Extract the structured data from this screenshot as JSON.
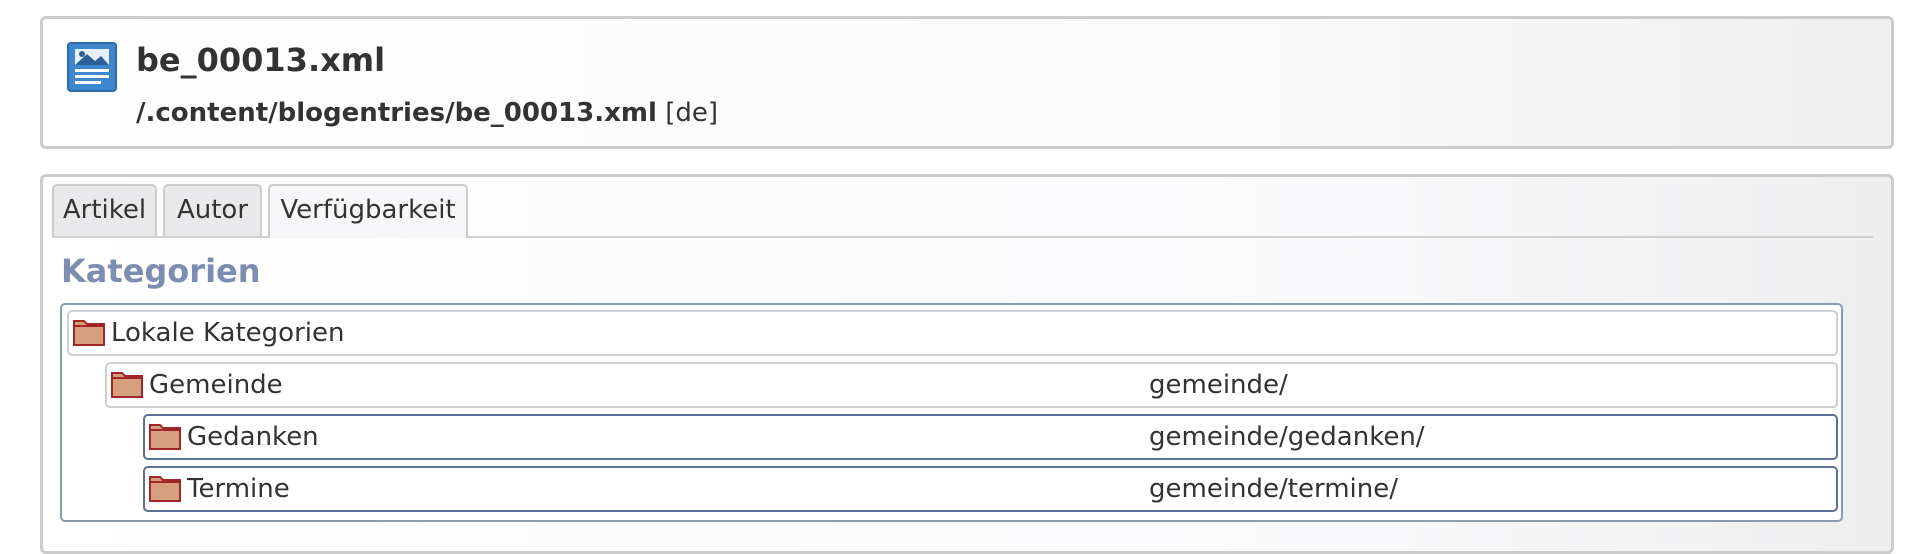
{
  "header": {
    "file_name": "be_00013.xml",
    "file_path": "/.content/blogentries/be_00013.xml",
    "locale": "[de]",
    "icon": "document-image-icon"
  },
  "tabs": [
    {
      "label": "Artikel",
      "active": false
    },
    {
      "label": "Autor",
      "active": false
    },
    {
      "label": "Verfügbarkeit",
      "active": true
    }
  ],
  "section": {
    "title": "Kategorien"
  },
  "categories": [
    {
      "label": "Lokale Kategorien",
      "path": "",
      "level": 0,
      "icon": "folder-icon",
      "selected": false
    },
    {
      "label": "Gemeinde",
      "path": "gemeinde/",
      "level": 1,
      "icon": "folder-icon",
      "selected": false
    },
    {
      "label": "Gedanken",
      "path": "gemeinde/gedanken/",
      "level": 2,
      "icon": "folder-icon",
      "selected": true
    },
    {
      "label": "Termine",
      "path": "gemeinde/termine/",
      "level": 2,
      "icon": "folder-icon",
      "selected": true
    }
  ],
  "colors": {
    "section_title": "#7d8db2",
    "folder_fill": "#d6a07e",
    "folder_stroke": "#a0262a",
    "file_icon": "#3e87cf"
  }
}
